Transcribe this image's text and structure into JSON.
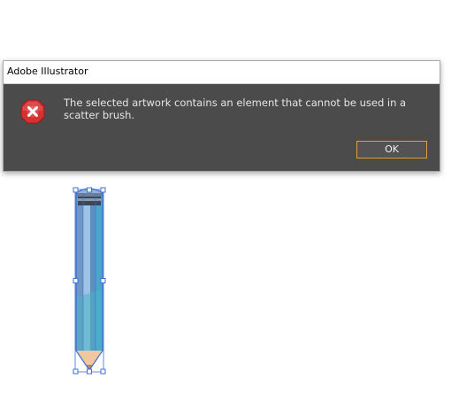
{
  "dialog": {
    "title": "Adobe Illustrator",
    "message": "The selected artwork contains an element that cannot be used in a scatter brush.",
    "ok_label": "OK",
    "icon": "error-icon"
  },
  "artwork": {
    "icon": "pencil-icon",
    "selected": true
  },
  "colors": {
    "dialog_bg": "#4b4b4b",
    "titlebar_bg": "#ffffff",
    "button_border": "#e39b3c",
    "error_red": "#d6302f",
    "selection_blue": "#3d6fd8"
  }
}
